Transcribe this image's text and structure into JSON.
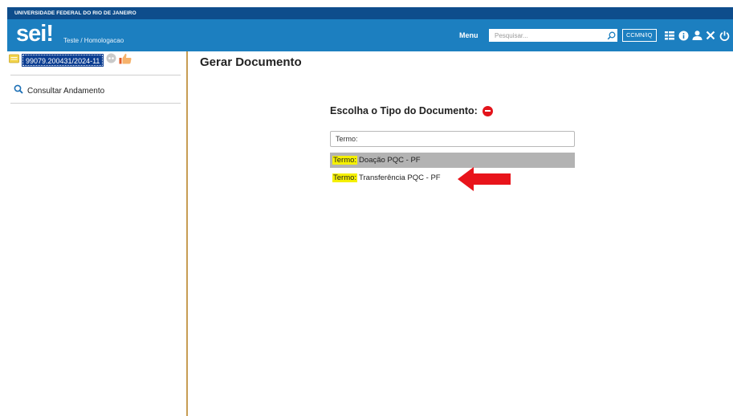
{
  "header": {
    "university": "UNIVERSIDADE FEDERAL DO RIO DE JANEIRO",
    "logo": "sei",
    "logo_suffix": "!",
    "environment": "Teste / Homologacao",
    "menu_label": "Menu",
    "search_placeholder": "Pesquisar...",
    "unit": "CCMN/IQ",
    "icons": [
      "search-icon",
      "control-panel-icon",
      "info-icon",
      "user-icon",
      "tools-icon",
      "logout-icon"
    ]
  },
  "sidebar": {
    "process_number": "99079.200431/2024-11",
    "consult_label": "Consultar Andamento",
    "icons": [
      "folder-icon",
      "view-icon",
      "hand-icon",
      "magnifier-icon"
    ]
  },
  "main": {
    "title": "Gerar Documento",
    "chooser_title": "Escolha o Tipo do Documento:",
    "filter_value": "Termo:",
    "options": [
      {
        "highlight": "Termo:",
        "rest": " Doação PQC - PF"
      },
      {
        "highlight": "Termo:",
        "rest": " Transferência PQC - PF"
      }
    ]
  },
  "colors": {
    "header_blue": "#1c7fc0",
    "header_dark": "#0e4d8c",
    "process_blue": "#0b3d91",
    "highlight_yellow": "#f5f000",
    "selected_gray": "#b3b3b3",
    "arrow_red": "#e3141b",
    "sidebar_border": "#c79d54"
  }
}
